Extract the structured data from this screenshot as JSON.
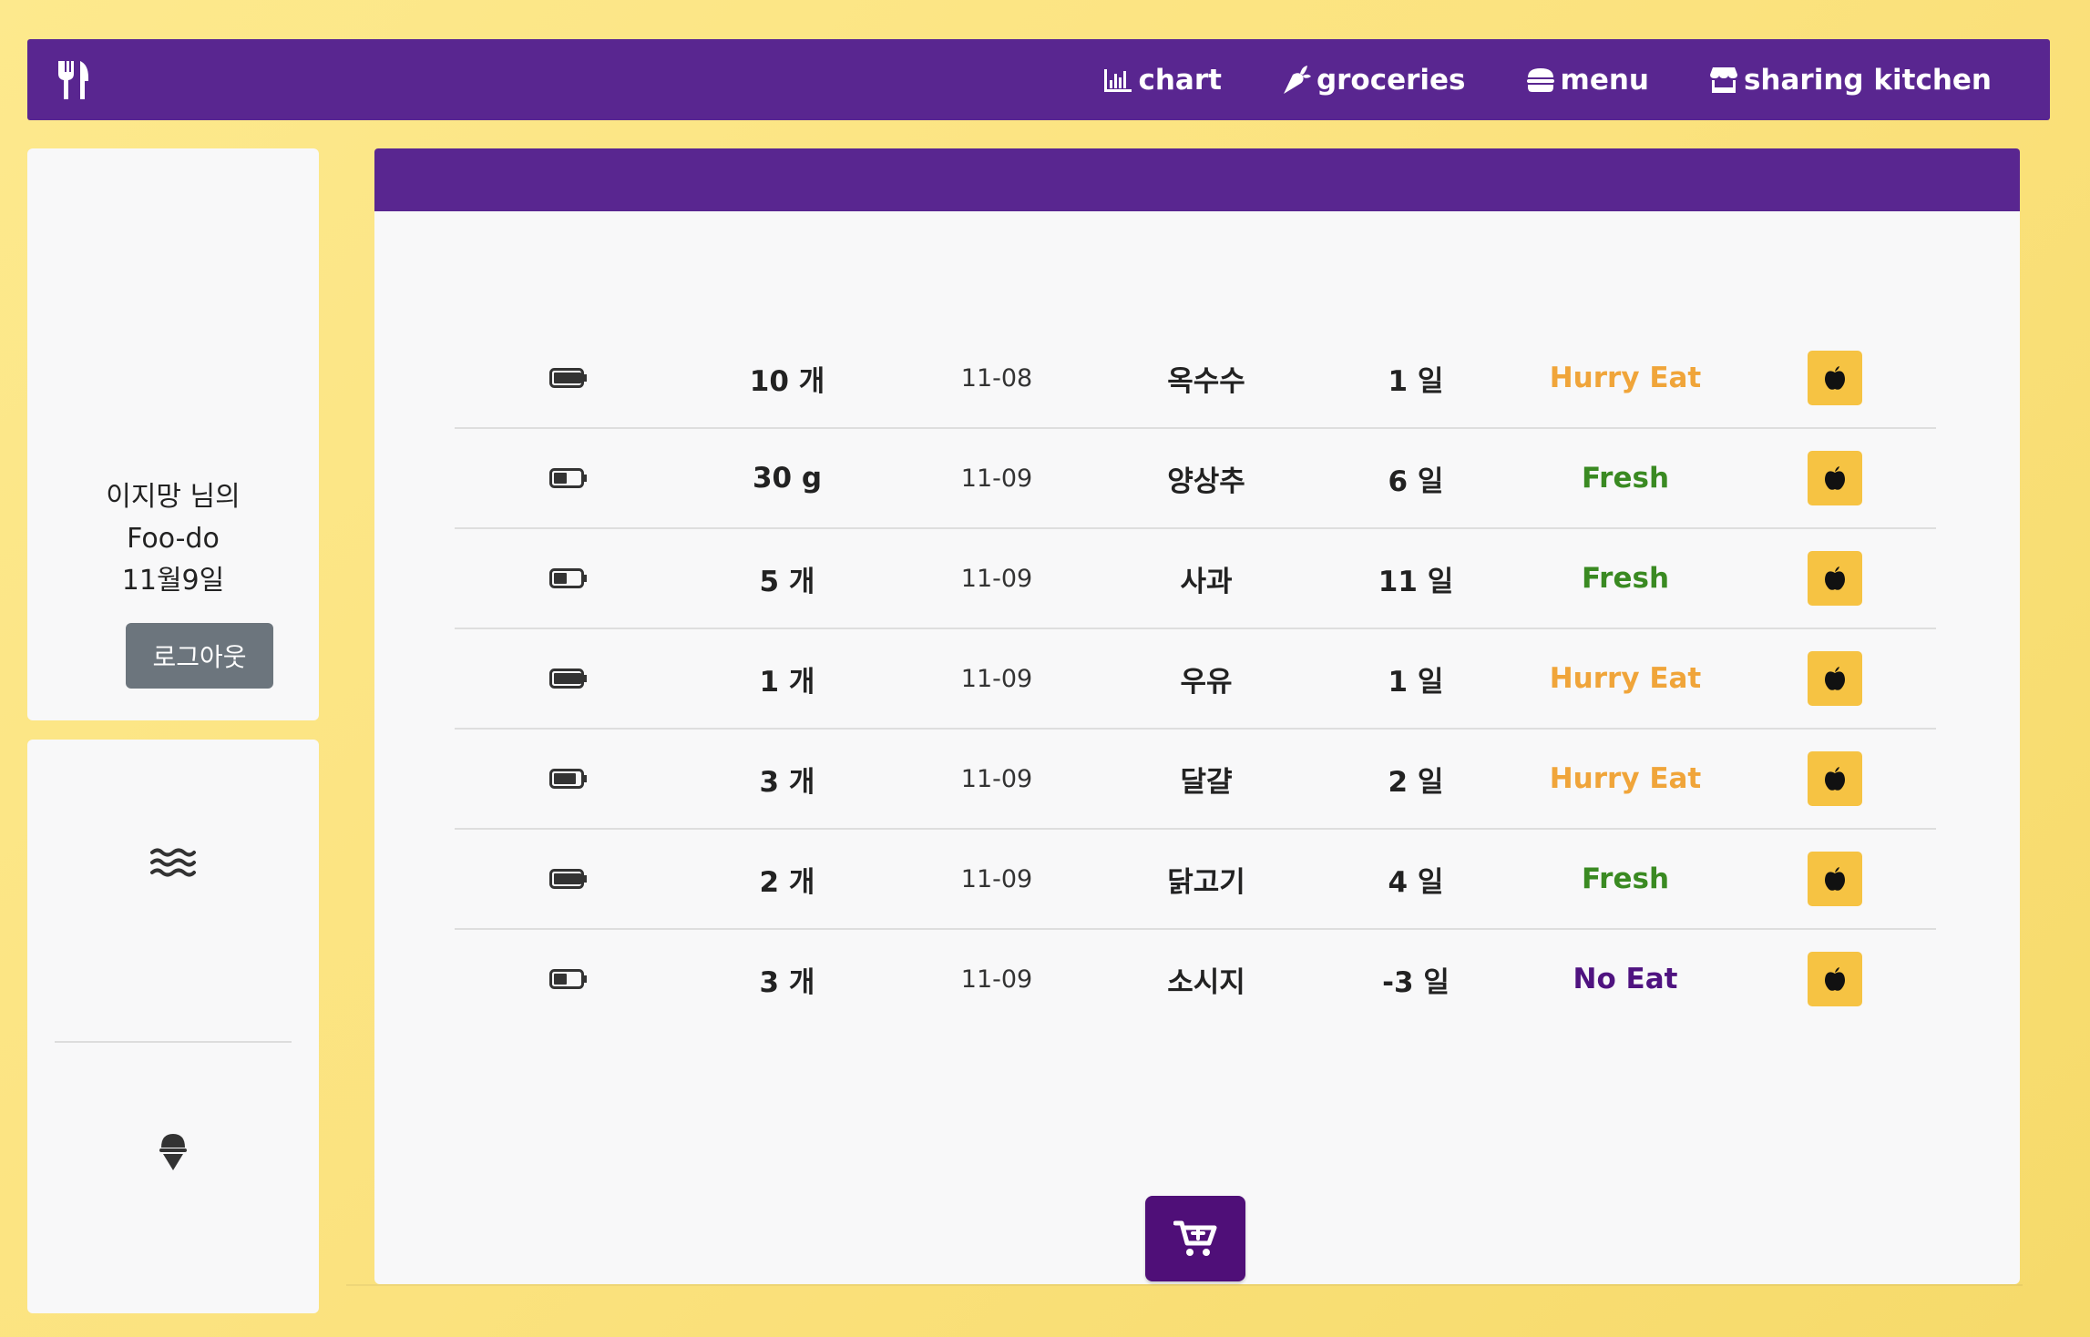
{
  "nav": {
    "brand_icon": "utensils-icon",
    "items": [
      {
        "label": "chart",
        "icon": "chart-bar-icon"
      },
      {
        "label": "groceries",
        "icon": "carrot-icon"
      },
      {
        "label": "menu",
        "icon": "hamburger-icon"
      },
      {
        "label": "sharing kitchen",
        "icon": "store-icon"
      }
    ]
  },
  "profile": {
    "greeting": "이지망 님의",
    "app_name": "Foo-do",
    "date": "11월9일",
    "logout_label": "로그아웃"
  },
  "side": {
    "top_icon": "water-waves-icon",
    "bottom_icon": "ice-cream-icon"
  },
  "colors": {
    "primary": "#592690",
    "accent": "#f6c343",
    "hurry": "#f0a53a",
    "fresh": "#3a8a22",
    "noeat": "#4f1380"
  },
  "items": [
    {
      "battery": "battery-full-icon",
      "qty": "10 개",
      "date": "11-08",
      "name": "옥수수",
      "days": "1 일",
      "status": "Hurry Eat",
      "status_type": "hurry"
    },
    {
      "battery": "battery-half-icon",
      "qty": "30 g",
      "date": "11-09",
      "name": "양상추",
      "days": "6 일",
      "status": "Fresh",
      "status_type": "fresh"
    },
    {
      "battery": "battery-half-icon",
      "qty": "5 개",
      "date": "11-09",
      "name": "사과",
      "days": "11 일",
      "status": "Fresh",
      "status_type": "fresh"
    },
    {
      "battery": "battery-full-icon",
      "qty": "1 개",
      "date": "11-09",
      "name": "우유",
      "days": "1 일",
      "status": "Hurry Eat",
      "status_type": "hurry"
    },
    {
      "battery": "battery-three-quarters-icon",
      "qty": "3 개",
      "date": "11-09",
      "name": "달걀",
      "days": "2 일",
      "status": "Hurry Eat",
      "status_type": "hurry"
    },
    {
      "battery": "battery-full-icon",
      "qty": "2 개",
      "date": "11-09",
      "name": "닭고기",
      "days": "4 일",
      "status": "Fresh",
      "status_type": "fresh"
    },
    {
      "battery": "battery-half-icon",
      "qty": "3 개",
      "date": "11-09",
      "name": "소시지",
      "days": "-3 일",
      "status": "No Eat",
      "status_type": "noeat"
    }
  ],
  "cart_button_icon": "cart-plus-icon"
}
